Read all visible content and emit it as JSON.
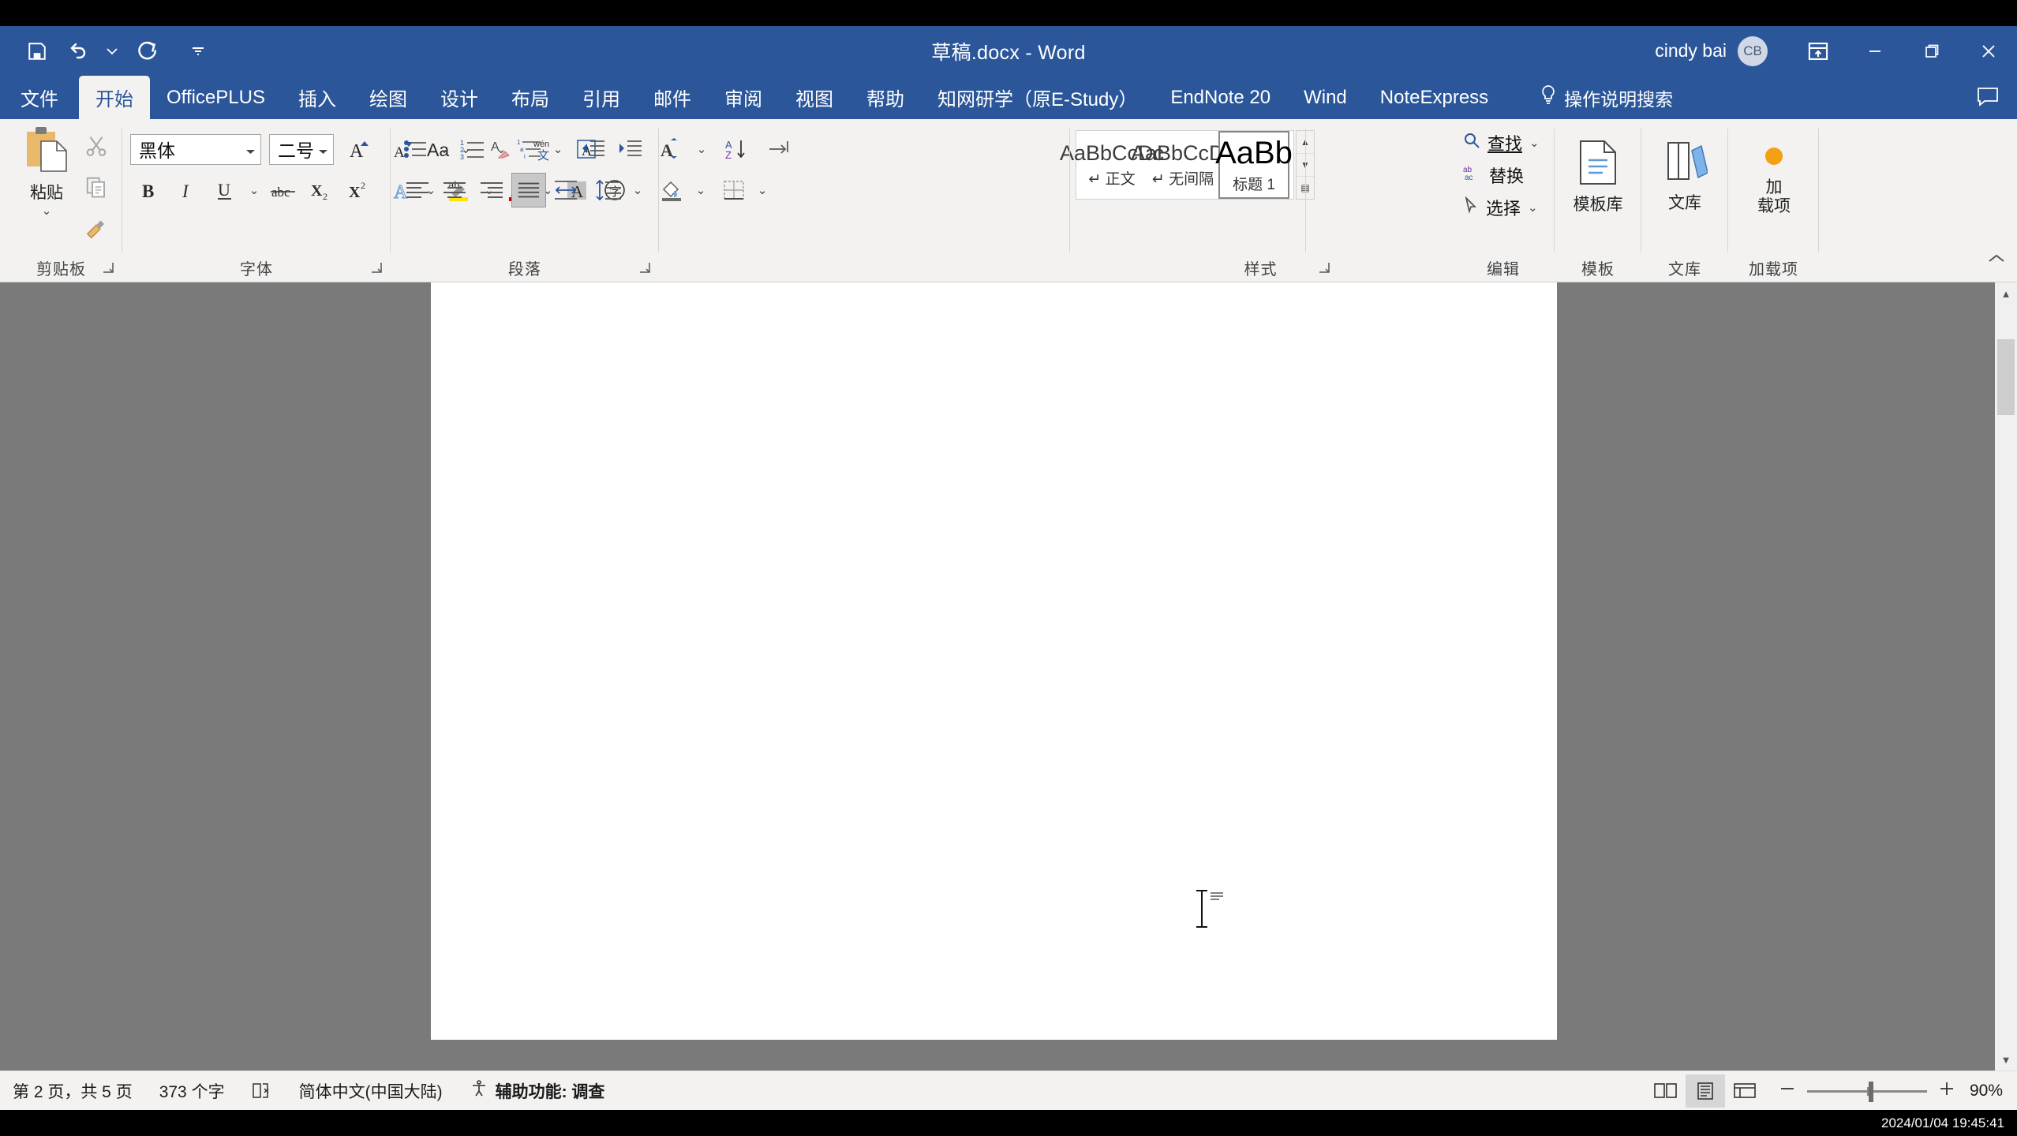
{
  "window": {
    "title": "草稿.docx  -  Word",
    "user_name": "cindy bai",
    "avatar_initials": "CB",
    "accent_color": "#2b579a"
  },
  "quick_access": [
    {
      "name": "save-icon",
      "label": "保存"
    },
    {
      "name": "undo-icon",
      "label": "撤消"
    },
    {
      "name": "redo-icon",
      "label": "重复"
    },
    {
      "name": "customize-qat-icon",
      "label": "自定义快速访问工具栏"
    }
  ],
  "window_buttons": [
    {
      "name": "ribbon-display-options-button",
      "label": "功能区显示选项"
    },
    {
      "name": "minimize-button",
      "label": "最小化"
    },
    {
      "name": "restore-button",
      "label": "向下还原"
    },
    {
      "name": "close-button",
      "label": "关闭"
    }
  ],
  "tabs": [
    {
      "label": "文件",
      "active": false
    },
    {
      "label": "开始",
      "active": true
    },
    {
      "label": "OfficePLUS",
      "active": false
    },
    {
      "label": "插入",
      "active": false
    },
    {
      "label": "绘图",
      "active": false
    },
    {
      "label": "设计",
      "active": false
    },
    {
      "label": "布局",
      "active": false
    },
    {
      "label": "引用",
      "active": false
    },
    {
      "label": "邮件",
      "active": false
    },
    {
      "label": "审阅",
      "active": false
    },
    {
      "label": "视图",
      "active": false
    },
    {
      "label": "帮助",
      "active": false
    },
    {
      "label": "知网研学（原E-Study）",
      "active": false
    },
    {
      "label": "EndNote 20",
      "active": false
    },
    {
      "label": "Wind",
      "active": false
    },
    {
      "label": "NoteExpress",
      "active": false
    }
  ],
  "tell_me": {
    "label": "操作说明搜索"
  },
  "ribbon": {
    "groups": [
      {
        "key": "clipboard",
        "label": "剪贴板",
        "paste_label": "粘贴",
        "items": [
          {
            "name": "cut-icon",
            "label": "剪切"
          },
          {
            "name": "copy-icon",
            "label": "复制"
          },
          {
            "name": "format-painter-icon",
            "label": "格式刷"
          }
        ]
      },
      {
        "key": "font",
        "label": "字体",
        "font_name": "黑体",
        "font_size": "二号",
        "items": [
          {
            "name": "grow-font-icon",
            "label": "增大字号"
          },
          {
            "name": "shrink-font-icon",
            "label": "减小字号"
          },
          {
            "name": "change-case-icon",
            "label": "更改大小写"
          },
          {
            "name": "clear-formatting-icon",
            "label": "清除所有格式"
          },
          {
            "name": "phonetic-guide-icon",
            "label": "拼音指南"
          },
          {
            "name": "character-border-icon",
            "label": "字符边框"
          },
          {
            "name": "bold-icon",
            "label": "加粗"
          },
          {
            "name": "italic-icon",
            "label": "倾斜"
          },
          {
            "name": "underline-icon",
            "label": "下划线"
          },
          {
            "name": "strikethrough-icon",
            "label": "删除线"
          },
          {
            "name": "subscript-icon",
            "label": "下标"
          },
          {
            "name": "superscript-icon",
            "label": "上标"
          },
          {
            "name": "text-effects-icon",
            "label": "文本效果和版式"
          },
          {
            "name": "text-highlight-icon",
            "label": "文本突出显示颜色"
          },
          {
            "name": "font-color-icon",
            "label": "字体颜色"
          },
          {
            "name": "character-shading-icon",
            "label": "字符底纹"
          },
          {
            "name": "enclose-character-icon",
            "label": "带圈字符"
          }
        ]
      },
      {
        "key": "paragraph",
        "label": "段落",
        "items": [
          {
            "name": "bullets-icon",
            "label": "项目符号"
          },
          {
            "name": "numbering-icon",
            "label": "编号"
          },
          {
            "name": "multilevel-list-icon",
            "label": "多级列表"
          },
          {
            "name": "decrease-indent-icon",
            "label": "减少缩进量"
          },
          {
            "name": "increase-indent-icon",
            "label": "增加缩进量"
          },
          {
            "name": "sort-icon",
            "label": "排序"
          },
          {
            "name": "show-marks-icon",
            "label": "显示编辑标记"
          },
          {
            "name": "align-left-icon",
            "label": "左对齐"
          },
          {
            "name": "align-center-icon",
            "label": "居中"
          },
          {
            "name": "align-right-icon",
            "label": "右对齐"
          },
          {
            "name": "justify-icon",
            "label": "两端对齐",
            "active": true
          },
          {
            "name": "distribute-icon",
            "label": "分散对齐"
          },
          {
            "name": "line-spacing-icon",
            "label": "行和段落间距"
          },
          {
            "name": "shading-icon",
            "label": "底纹"
          },
          {
            "name": "borders-icon",
            "label": "边框"
          }
        ]
      },
      {
        "key": "styles",
        "label": "样式",
        "gallery": [
          {
            "preview": "AaBbCcDc",
            "name": "正文",
            "selected": false
          },
          {
            "preview": "AaBbCcDc",
            "name": "无间隔",
            "selected": false
          },
          {
            "preview": "AaBb",
            "name": "标题 1",
            "selected": true
          }
        ]
      },
      {
        "key": "editing",
        "label": "编辑",
        "items": [
          {
            "name": "find-icon",
            "label": "查找"
          },
          {
            "name": "replace-icon",
            "label": "替换"
          },
          {
            "name": "select-icon",
            "label": "选择"
          }
        ]
      },
      {
        "key": "template",
        "label": "模板",
        "button_label": "模板库"
      },
      {
        "key": "library",
        "label": "文库",
        "button_label": "文库"
      },
      {
        "key": "addins",
        "label": "加载项",
        "button_label": "加\n载项"
      }
    ],
    "collapse_label": "折叠功能区"
  },
  "status_bar": {
    "page_info": "第 2 页，共 5 页",
    "word_count": "373 个字",
    "proofing_name": "proofing-errors-icon",
    "language": "简体中文(中国大陆)",
    "accessibility": "辅助功能: 调查",
    "views": [
      {
        "name": "read-mode-button",
        "label": "阅读视图",
        "active": false
      },
      {
        "name": "print-layout-button",
        "label": "页面视图",
        "active": true
      },
      {
        "name": "web-layout-button",
        "label": "Web 版式视图",
        "active": false
      }
    ],
    "zoom_out_label": "缩小",
    "zoom_in_label": "放大",
    "zoom_value": "90%"
  },
  "taskbar": {
    "clock": "2024/01/04 19:45:41"
  }
}
